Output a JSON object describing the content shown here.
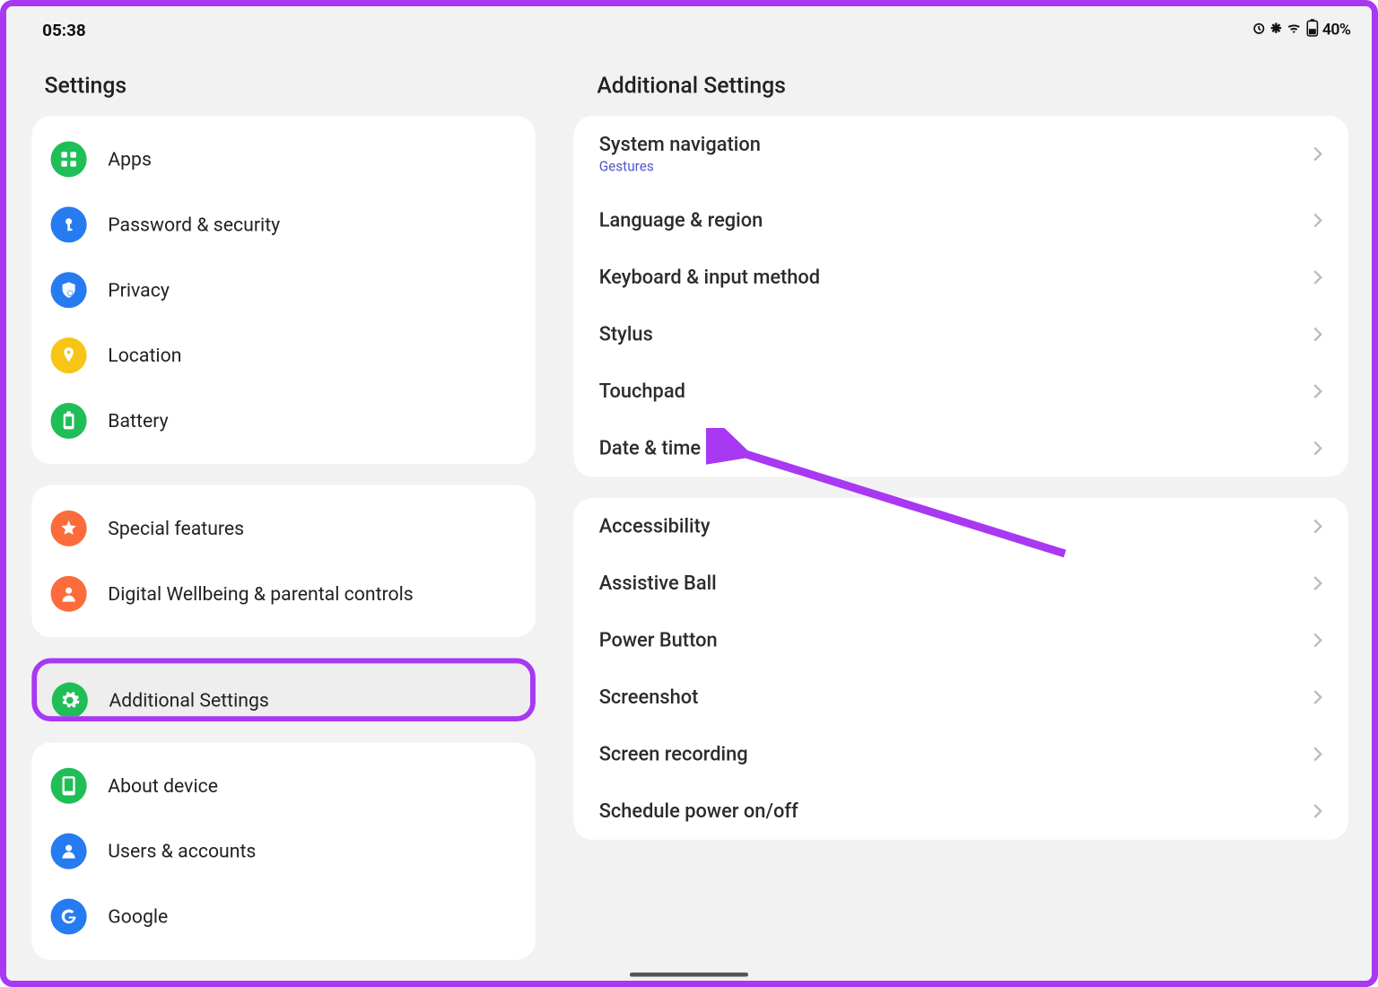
{
  "status": {
    "time": "05:38",
    "battery": "40%"
  },
  "left_title": "Settings",
  "right_title": "Additional Settings",
  "sidebar": {
    "group1": [
      {
        "id": "apps",
        "label": "Apps"
      },
      {
        "id": "password-security",
        "label": "Password & security"
      },
      {
        "id": "privacy",
        "label": "Privacy"
      },
      {
        "id": "location",
        "label": "Location"
      },
      {
        "id": "battery",
        "label": "Battery"
      }
    ],
    "group2": [
      {
        "id": "special-features",
        "label": "Special features"
      },
      {
        "id": "digital-wellbeing",
        "label": "Digital Wellbeing & parental controls"
      }
    ],
    "selected": {
      "id": "additional-settings",
      "label": "Additional Settings"
    },
    "group3": [
      {
        "id": "about-device",
        "label": "About device"
      },
      {
        "id": "users-accounts",
        "label": "Users & accounts"
      },
      {
        "id": "google",
        "label": "Google"
      }
    ]
  },
  "detail": {
    "group1": [
      {
        "id": "system-navigation",
        "label": "System navigation",
        "sub": "Gestures"
      },
      {
        "id": "language-region",
        "label": "Language & region"
      },
      {
        "id": "keyboard-input",
        "label": "Keyboard & input method"
      },
      {
        "id": "stylus",
        "label": "Stylus"
      },
      {
        "id": "touchpad",
        "label": "Touchpad"
      },
      {
        "id": "date-time",
        "label": "Date & time"
      }
    ],
    "group2": [
      {
        "id": "accessibility",
        "label": "Accessibility"
      },
      {
        "id": "assistive-ball",
        "label": "Assistive Ball"
      },
      {
        "id": "power-button",
        "label": "Power Button"
      },
      {
        "id": "screenshot",
        "label": "Screenshot"
      },
      {
        "id": "screen-recording",
        "label": "Screen recording"
      },
      {
        "id": "schedule-power",
        "label": "Schedule power on/off"
      }
    ]
  },
  "annotation": {
    "arrow_target": "touchpad"
  }
}
